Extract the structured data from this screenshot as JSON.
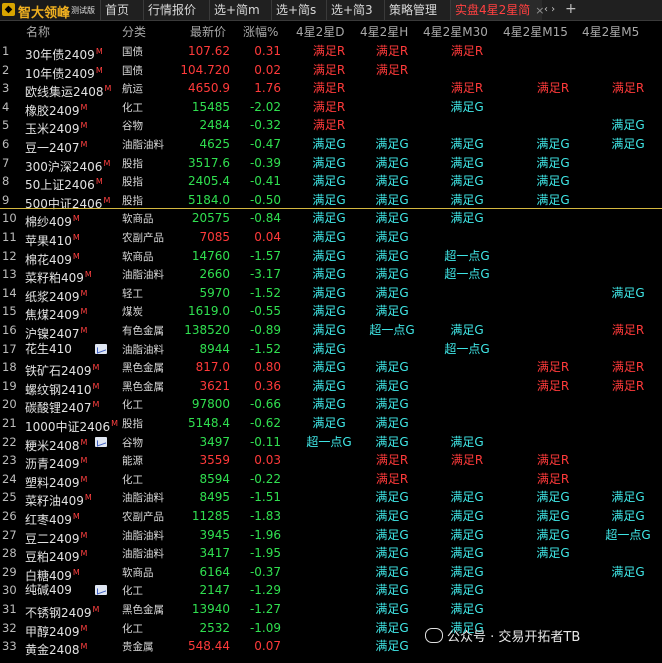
{
  "app": {
    "name": "智大领峰",
    "tag": "测试版"
  },
  "tabs": [
    {
      "label": "首页",
      "active": false
    },
    {
      "label": "行情报价",
      "active": false
    },
    {
      "label": "选+简m",
      "active": false
    },
    {
      "label": "选+简s",
      "active": false
    },
    {
      "label": "选+简3",
      "active": false
    },
    {
      "label": "策略管理",
      "active": false
    },
    {
      "label": "实盘4星2星简",
      "active": true,
      "close": "×"
    }
  ],
  "tab_controls": {
    "arrows": "‹  ›",
    "add": "+"
  },
  "columns": [
    "名称",
    "分类",
    "最新价",
    "涨幅%",
    "4星2星D",
    "4星2星H",
    "4星2星M30",
    "4星2星M15",
    "4星2星M5"
  ],
  "colors": {
    "red": "#ff3a3a",
    "green": "#30e050",
    "cyan": "#40e8e8",
    "accent": "#d8a400"
  },
  "rows": [
    {
      "n": "1",
      "name": "30年债2409",
      "m": "M",
      "cat": "国债",
      "price": "107.62",
      "chg": "0.31",
      "d": "满足R",
      "h": "满足R",
      "m30": "满足R",
      "m15": "",
      "m5": ""
    },
    {
      "n": "2",
      "name": "10年债2409",
      "m": "M",
      "cat": "国债",
      "price": "104.720",
      "chg": "0.02",
      "d": "满足R",
      "h": "满足R",
      "m30": "",
      "m15": "",
      "m5": ""
    },
    {
      "n": "3",
      "name": "欧线集运2408",
      "m": "M",
      "cat": "航运",
      "price": "4650.9",
      "chg": "1.76",
      "d": "满足R",
      "h": "",
      "m30": "满足R",
      "m15": "满足R",
      "m5": "满足R"
    },
    {
      "n": "4",
      "name": "橡胶2409",
      "m": "M",
      "cat": "化工",
      "price": "15485",
      "chg": "-2.02",
      "d": "满足R",
      "h": "",
      "m30": "满足G",
      "m15": "",
      "m5": ""
    },
    {
      "n": "5",
      "name": "玉米2409",
      "m": "M",
      "cat": "谷物",
      "price": "2484",
      "chg": "-0.32",
      "d": "满足R",
      "h": "",
      "m30": "",
      "m15": "",
      "m5": "满足G"
    },
    {
      "n": "6",
      "name": "豆一2407",
      "m": "M",
      "cat": "油脂油料",
      "price": "4625",
      "chg": "-0.47",
      "d": "满足G",
      "h": "满足G",
      "m30": "满足G",
      "m15": "满足G",
      "m5": "满足G"
    },
    {
      "n": "7",
      "name": "300沪深2406",
      "m": "M",
      "cat": "股指",
      "price": "3517.6",
      "chg": "-0.39",
      "d": "满足G",
      "h": "满足G",
      "m30": "满足G",
      "m15": "满足G",
      "m5": ""
    },
    {
      "n": "8",
      "name": "50上证2406",
      "m": "M",
      "cat": "股指",
      "price": "2405.4",
      "chg": "-0.41",
      "d": "满足G",
      "h": "满足G",
      "m30": "满足G",
      "m15": "满足G",
      "m5": ""
    },
    {
      "n": "9",
      "name": "500中证2406",
      "m": "M",
      "cat": "股指",
      "price": "5184.0",
      "chg": "-0.50",
      "d": "满足G",
      "h": "满足G",
      "m30": "满足G",
      "m15": "满足G",
      "m5": ""
    },
    {
      "n": "10",
      "name": "棉纱409",
      "m": "M",
      "cat": "软商品",
      "price": "20575",
      "chg": "-0.84",
      "d": "满足G",
      "h": "满足G",
      "m30": "满足G",
      "m15": "",
      "m5": ""
    },
    {
      "n": "11",
      "name": "苹果410",
      "m": "M",
      "cat": "农副产品",
      "price": "7085",
      "chg": "0.04",
      "d": "满足G",
      "h": "满足G",
      "m30": "",
      "m15": "",
      "m5": ""
    },
    {
      "n": "12",
      "name": "棉花409",
      "m": "M",
      "cat": "软商品",
      "price": "14760",
      "chg": "-1.57",
      "d": "满足G",
      "h": "满足G",
      "m30": "超一点G",
      "m15": "",
      "m5": ""
    },
    {
      "n": "13",
      "name": "菜籽粕409",
      "m": "M",
      "cat": "油脂油料",
      "price": "2660",
      "chg": "-3.17",
      "d": "满足G",
      "h": "满足G",
      "m30": "超一点G",
      "m15": "",
      "m5": ""
    },
    {
      "n": "14",
      "name": "纸浆2409",
      "m": "M",
      "cat": "轻工",
      "price": "5970",
      "chg": "-1.52",
      "d": "满足G",
      "h": "满足G",
      "m30": "",
      "m15": "",
      "m5": "满足G"
    },
    {
      "n": "15",
      "name": "焦煤2409",
      "m": "M",
      "cat": "煤炭",
      "price": "1619.0",
      "chg": "-0.55",
      "d": "满足G",
      "h": "满足G",
      "m30": "",
      "m15": "",
      "m5": ""
    },
    {
      "n": "16",
      "name": "沪镍2407",
      "m": "M",
      "cat": "有色金属",
      "price": "138520",
      "chg": "-0.89",
      "d": "满足G",
      "h": "超一点G",
      "m30": "满足G",
      "m15": "",
      "m5": "满足R"
    },
    {
      "n": "17",
      "name": "花生410",
      "m": "",
      "chip": true,
      "cat": "油脂油料",
      "price": "8944",
      "chg": "-1.52",
      "d": "满足G",
      "h": "",
      "m30": "超一点G",
      "m15": "",
      "m5": ""
    },
    {
      "n": "18",
      "name": "铁矿石2409",
      "m": "M",
      "cat": "黑色金属",
      "price": "817.0",
      "chg": "0.80",
      "d": "满足G",
      "h": "满足G",
      "m30": "",
      "m15": "满足R",
      "m5": "满足R"
    },
    {
      "n": "19",
      "name": "螺纹钢2410",
      "m": "M",
      "cat": "黑色金属",
      "price": "3621",
      "chg": "0.36",
      "d": "满足G",
      "h": "满足G",
      "m30": "",
      "m15": "满足R",
      "m5": "满足R"
    },
    {
      "n": "20",
      "name": "碳酸锂2407",
      "m": "M",
      "cat": "化工",
      "price": "97800",
      "chg": "-0.66",
      "d": "满足G",
      "h": "满足G",
      "m30": "",
      "m15": "",
      "m5": ""
    },
    {
      "n": "21",
      "name": "1000中证2406",
      "m": "M",
      "cat": "股指",
      "price": "5148.4",
      "chg": "-0.62",
      "d": "满足G",
      "h": "满足G",
      "m30": "",
      "m15": "",
      "m5": ""
    },
    {
      "n": "22",
      "name": "粳米2408",
      "m": "M",
      "chip": true,
      "cat": "谷物",
      "price": "3497",
      "chg": "-0.11",
      "d": "超一点G",
      "h": "满足G",
      "m30": "满足G",
      "m15": "",
      "m5": ""
    },
    {
      "n": "23",
      "name": "沥青2409",
      "m": "M",
      "cat": "能源",
      "price": "3559",
      "chg": "0.03",
      "d": "",
      "h": "满足R",
      "m30": "满足R",
      "m15": "满足R",
      "m5": ""
    },
    {
      "n": "24",
      "name": "塑料2409",
      "m": "M",
      "cat": "化工",
      "price": "8594",
      "chg": "-0.22",
      "d": "",
      "h": "满足R",
      "m30": "",
      "m15": "满足R",
      "m5": ""
    },
    {
      "n": "25",
      "name": "菜籽油409",
      "m": "M",
      "cat": "油脂油料",
      "price": "8495",
      "chg": "-1.51",
      "d": "",
      "h": "满足G",
      "m30": "满足G",
      "m15": "满足G",
      "m5": "满足G"
    },
    {
      "n": "26",
      "name": "红枣409",
      "m": "M",
      "cat": "农副产品",
      "price": "11285",
      "chg": "-1.83",
      "d": "",
      "h": "满足G",
      "m30": "满足G",
      "m15": "满足G",
      "m5": "满足G"
    },
    {
      "n": "27",
      "name": "豆二2409",
      "m": "M",
      "cat": "油脂油料",
      "price": "3945",
      "chg": "-1.96",
      "d": "",
      "h": "满足G",
      "m30": "满足G",
      "m15": "满足G",
      "m5": "超一点G"
    },
    {
      "n": "28",
      "name": "豆粕2409",
      "m": "M",
      "cat": "油脂油料",
      "price": "3417",
      "chg": "-1.95",
      "d": "",
      "h": "满足G",
      "m30": "满足G",
      "m15": "满足G",
      "m5": ""
    },
    {
      "n": "29",
      "name": "白糖409",
      "m": "M",
      "cat": "软商品",
      "price": "6164",
      "chg": "-0.37",
      "d": "",
      "h": "满足G",
      "m30": "满足G",
      "m15": "",
      "m5": "满足G"
    },
    {
      "n": "30",
      "name": "纯碱409",
      "m": "",
      "chip": true,
      "cat": "化工",
      "price": "2147",
      "chg": "-1.29",
      "d": "",
      "h": "满足G",
      "m30": "满足G",
      "m15": "",
      "m5": ""
    },
    {
      "n": "31",
      "name": "不锈钢2409",
      "m": "M",
      "cat": "黑色金属",
      "price": "13940",
      "chg": "-1.27",
      "d": "",
      "h": "满足G",
      "m30": "满足G",
      "m15": "",
      "m5": ""
    },
    {
      "n": "32",
      "name": "甲醇2409",
      "m": "M",
      "cat": "化工",
      "price": "2532",
      "chg": "-1.09",
      "d": "",
      "h": "满足G",
      "m30": "满足G",
      "m15": "",
      "m5": ""
    },
    {
      "n": "33",
      "name": "黄金2408",
      "m": "M",
      "cat": "贵金属",
      "price": "548.44",
      "chg": "0.07",
      "d": "",
      "h": "满足G",
      "m30": "",
      "m15": "",
      "m5": ""
    }
  ],
  "watermark": "公众号 · 交易开拓者TB"
}
